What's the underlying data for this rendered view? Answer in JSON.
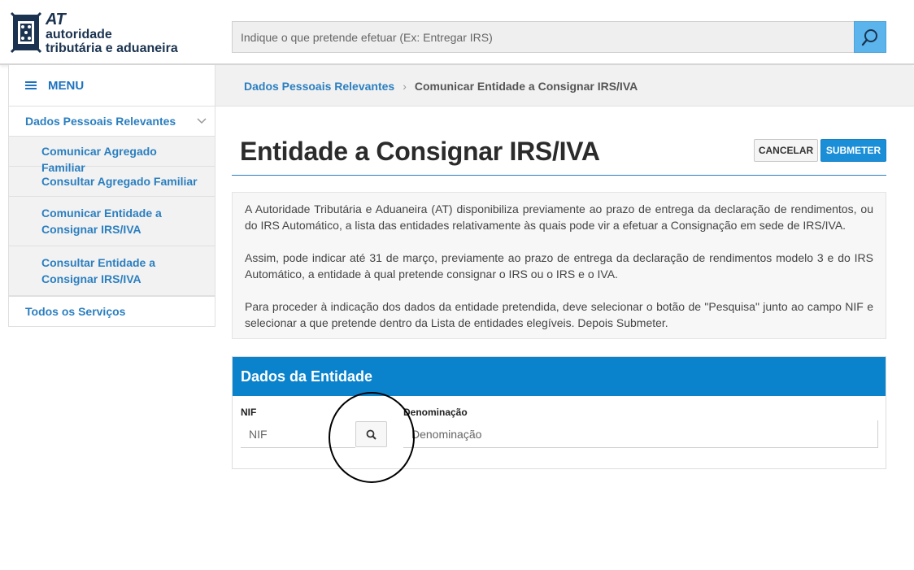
{
  "header": {
    "logo": {
      "abbr": "AT",
      "line1": "autoridade",
      "line2": "tributária e aduaneira"
    },
    "search": {
      "placeholder": "Indique o que pretende efetuar (Ex: Entregar IRS)",
      "button_icon": "search-icon"
    }
  },
  "breadcrumb": {
    "items": [
      "Dados Pessoais Relevantes",
      "Comunicar Entidade a Consignar IRS/IVA"
    ],
    "separator": "›"
  },
  "sidebar": {
    "menu_label": "MENU",
    "group": {
      "title": "Dados Pessoais Relevantes",
      "items": [
        {
          "label": "Comunicar Agregado Familiar"
        },
        {
          "label": "Consultar Agregado Familiar"
        },
        {
          "label": "Comunicar Entidade a Consignar IRS/IVA"
        },
        {
          "label": "Consultar Entidade a Consignar IRS/IVA"
        }
      ]
    },
    "all_services": "Todos os Serviços"
  },
  "main": {
    "title": "Entidade a Consignar IRS/IVA",
    "cancel_label": "CANCELAR",
    "submit_label": "SUBMETER",
    "info": [
      "A Autoridade Tributária e Aduaneira (AT) disponibiliza previamente ao prazo de entrega da declaração de rendimentos, ou do IRS Automático, a lista das entidades relativamente às quais pode vir a efetuar a Consignação em sede de IRS/IVA.",
      "Assim, pode indicar até 31 de março, previamente ao prazo de entrega da declaração de rendimentos modelo 3 e do IRS Automático, a entidade à qual pretende consignar o IRS ou o IRS e o IVA.",
      "Para proceder à indicação dos dados da entidade pretendida, deve selecionar o botão de \"Pesquisa\" junto ao campo NIF e selecionar a que pretende dentro da Lista de entidades elegíveis. Depois Submeter."
    ],
    "panel": {
      "title": "Dados da Entidade",
      "nif_label": "NIF",
      "nif_placeholder": "NIF",
      "nif_value": "",
      "den_label": "Denominação",
      "den_placeholder": "Denominação",
      "den_value": ""
    }
  },
  "colors": {
    "brand_blue": "#0a82cc",
    "link_blue": "#2b7fc0",
    "search_button": "#5bb4ec"
  }
}
